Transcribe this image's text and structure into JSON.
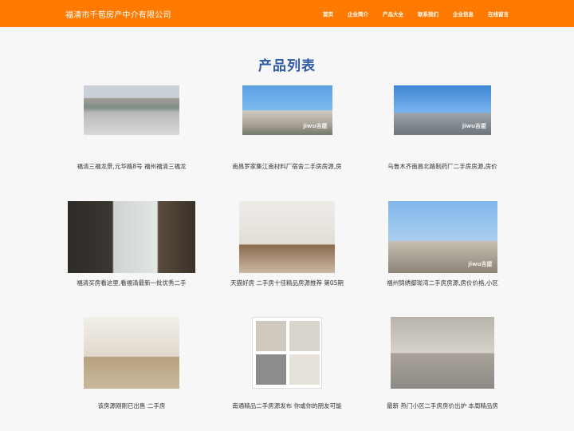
{
  "header": {
    "brand": "福清市千苞房产中介有限公司",
    "nav": [
      "首页",
      "企业简介",
      "产品大全",
      "联系我们",
      "企业信息",
      "在线留言"
    ]
  },
  "page_title": "产品列表",
  "products": [
    {
      "caption": "福清三福龙景,元华路8号 福州福清三福龙",
      "image": "building-roadside-photo"
    },
    {
      "caption": "南昌罗家集江南材料厂宿舍二手房房源,房",
      "image": "residential-building-photo"
    },
    {
      "caption": "乌鲁木齐南昌北路制药厂二手房房源,房价",
      "image": "street-tower-photo"
    },
    {
      "caption": "福清买房看这里,看福清最新一批优秀二手",
      "image": "living-room-people-photo"
    },
    {
      "caption": "天猫好房 二手房十佳精品房源推荐 第05期",
      "image": "apartment-interior-photo"
    },
    {
      "caption": "福州锦绣御珑湾二手房房源,房价价格,小区",
      "image": "highrise-towers-photo"
    },
    {
      "caption": "该房源刚刚已出售 二手房",
      "image": "furnished-living-room-photo"
    },
    {
      "caption": "南通精品二手房源发布 你或你的朋友可能",
      "image": "room-collage-photo"
    },
    {
      "caption": "最新 热门小区二手房房价出炉 本周精品房",
      "image": "bedroom-interior-photo"
    }
  ],
  "watermark": "jiwu吉屋"
}
